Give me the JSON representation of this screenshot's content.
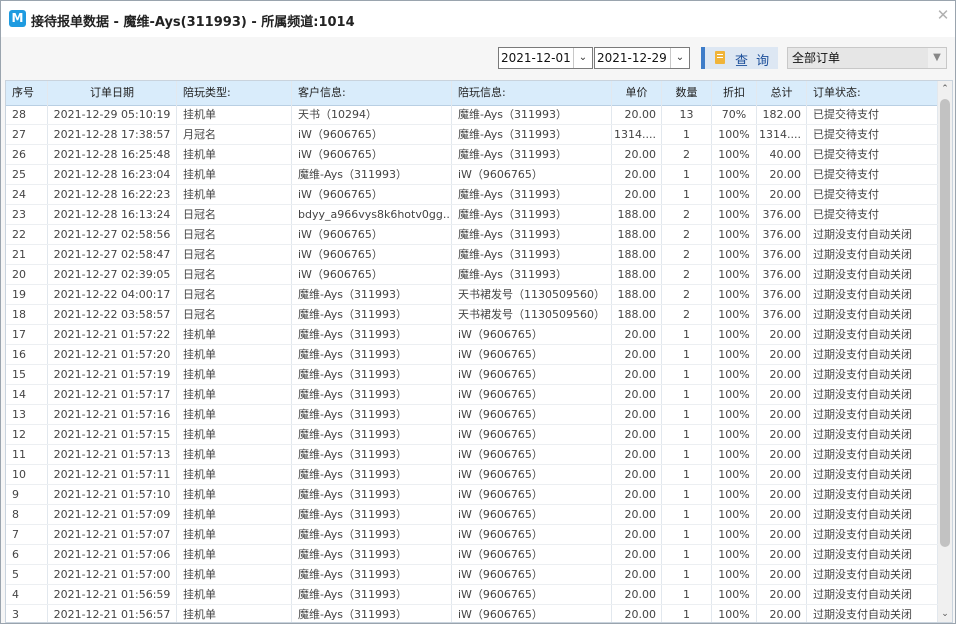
{
  "window": {
    "icon_letter": "M",
    "title": "接待报单数据 - 魔维-Ays(311993) - 所属频道:1014",
    "close_glyph": "✕"
  },
  "toolbar": {
    "date_from": "2021-12-01",
    "date_to": "2021-12-29",
    "query_label": "查 询",
    "status_filter": "全部订单"
  },
  "table": {
    "columns": [
      "序号",
      "订单日期",
      "陪玩类型:",
      "客户信息:",
      "陪玩信息:",
      "单价",
      "数量",
      "折扣",
      "总计",
      "订单状态:"
    ],
    "rows": [
      [
        "28",
        "2021-12-29 05:10:19",
        "挂机单",
        "天书（10294）",
        "魔维-Ays（311993）",
        "20.00",
        "13",
        "70%",
        "182.00",
        "已提交待支付"
      ],
      [
        "27",
        "2021-12-28 17:38:57",
        "月冠名",
        "iW（9606765）",
        "魔维-Ays（311993）",
        "1314....",
        "1",
        "100%",
        "1314....",
        "已提交待支付"
      ],
      [
        "26",
        "2021-12-28 16:25:48",
        "挂机单",
        "iW（9606765）",
        "魔维-Ays（311993）",
        "20.00",
        "2",
        "100%",
        "40.00",
        "已提交待支付"
      ],
      [
        "25",
        "2021-12-28 16:23:04",
        "挂机单",
        "魔维-Ays（311993）",
        "iW（9606765）",
        "20.00",
        "1",
        "100%",
        "20.00",
        "已提交待支付"
      ],
      [
        "24",
        "2021-12-28 16:22:23",
        "挂机单",
        "iW（9606765）",
        "魔维-Ays（311993）",
        "20.00",
        "1",
        "100%",
        "20.00",
        "已提交待支付"
      ],
      [
        "23",
        "2021-12-28 16:13:24",
        "日冠名",
        "bdyy_a966vys8k6hotv0gg...",
        "魔维-Ays（311993）",
        "188.00",
        "2",
        "100%",
        "376.00",
        "已提交待支付"
      ],
      [
        "22",
        "2021-12-27 02:58:56",
        "日冠名",
        "iW（9606765）",
        "魔维-Ays（311993）",
        "188.00",
        "2",
        "100%",
        "376.00",
        "过期没支付自动关闭"
      ],
      [
        "21",
        "2021-12-27 02:58:47",
        "日冠名",
        "iW（9606765）",
        "魔维-Ays（311993）",
        "188.00",
        "2",
        "100%",
        "376.00",
        "过期没支付自动关闭"
      ],
      [
        "20",
        "2021-12-27 02:39:05",
        "日冠名",
        "iW（9606765）",
        "魔维-Ays（311993）",
        "188.00",
        "2",
        "100%",
        "376.00",
        "过期没支付自动关闭"
      ],
      [
        "19",
        "2021-12-22 04:00:17",
        "日冠名",
        "魔维-Ays（311993）",
        "天书裙发号（1130509560）",
        "188.00",
        "2",
        "100%",
        "376.00",
        "过期没支付自动关闭"
      ],
      [
        "18",
        "2021-12-22 03:58:57",
        "日冠名",
        "魔维-Ays（311993）",
        "天书裙发号（1130509560）",
        "188.00",
        "2",
        "100%",
        "376.00",
        "过期没支付自动关闭"
      ],
      [
        "17",
        "2021-12-21 01:57:22",
        "挂机单",
        "魔维-Ays（311993）",
        "iW（9606765）",
        "20.00",
        "1",
        "100%",
        "20.00",
        "过期没支付自动关闭"
      ],
      [
        "16",
        "2021-12-21 01:57:20",
        "挂机单",
        "魔维-Ays（311993）",
        "iW（9606765）",
        "20.00",
        "1",
        "100%",
        "20.00",
        "过期没支付自动关闭"
      ],
      [
        "15",
        "2021-12-21 01:57:19",
        "挂机单",
        "魔维-Ays（311993）",
        "iW（9606765）",
        "20.00",
        "1",
        "100%",
        "20.00",
        "过期没支付自动关闭"
      ],
      [
        "14",
        "2021-12-21 01:57:17",
        "挂机单",
        "魔维-Ays（311993）",
        "iW（9606765）",
        "20.00",
        "1",
        "100%",
        "20.00",
        "过期没支付自动关闭"
      ],
      [
        "13",
        "2021-12-21 01:57:16",
        "挂机单",
        "魔维-Ays（311993）",
        "iW（9606765）",
        "20.00",
        "1",
        "100%",
        "20.00",
        "过期没支付自动关闭"
      ],
      [
        "12",
        "2021-12-21 01:57:15",
        "挂机单",
        "魔维-Ays（311993）",
        "iW（9606765）",
        "20.00",
        "1",
        "100%",
        "20.00",
        "过期没支付自动关闭"
      ],
      [
        "11",
        "2021-12-21 01:57:13",
        "挂机单",
        "魔维-Ays（311993）",
        "iW（9606765）",
        "20.00",
        "1",
        "100%",
        "20.00",
        "过期没支付自动关闭"
      ],
      [
        "10",
        "2021-12-21 01:57:11",
        "挂机单",
        "魔维-Ays（311993）",
        "iW（9606765）",
        "20.00",
        "1",
        "100%",
        "20.00",
        "过期没支付自动关闭"
      ],
      [
        "9",
        "2021-12-21 01:57:10",
        "挂机单",
        "魔维-Ays（311993）",
        "iW（9606765）",
        "20.00",
        "1",
        "100%",
        "20.00",
        "过期没支付自动关闭"
      ],
      [
        "8",
        "2021-12-21 01:57:09",
        "挂机单",
        "魔维-Ays（311993）",
        "iW（9606765）",
        "20.00",
        "1",
        "100%",
        "20.00",
        "过期没支付自动关闭"
      ],
      [
        "7",
        "2021-12-21 01:57:07",
        "挂机单",
        "魔维-Ays（311993）",
        "iW（9606765）",
        "20.00",
        "1",
        "100%",
        "20.00",
        "过期没支付自动关闭"
      ],
      [
        "6",
        "2021-12-21 01:57:06",
        "挂机单",
        "魔维-Ays（311993）",
        "iW（9606765）",
        "20.00",
        "1",
        "100%",
        "20.00",
        "过期没支付自动关闭"
      ],
      [
        "5",
        "2021-12-21 01:57:00",
        "挂机单",
        "魔维-Ays（311993）",
        "iW（9606765）",
        "20.00",
        "1",
        "100%",
        "20.00",
        "过期没支付自动关闭"
      ],
      [
        "4",
        "2021-12-21 01:56:59",
        "挂机单",
        "魔维-Ays（311993）",
        "iW（9606765）",
        "20.00",
        "1",
        "100%",
        "20.00",
        "过期没支付自动关闭"
      ],
      [
        "3",
        "2021-12-21 01:56:57",
        "挂机单",
        "魔维-Ays（311993）",
        "iW（9606765）",
        "20.00",
        "1",
        "100%",
        "20.00",
        "过期没支付自动关闭"
      ]
    ]
  },
  "colors": {
    "header_bg": "#d9ecfb",
    "accent": "#3d7cc9",
    "icon_bg": "#1e9be0"
  }
}
